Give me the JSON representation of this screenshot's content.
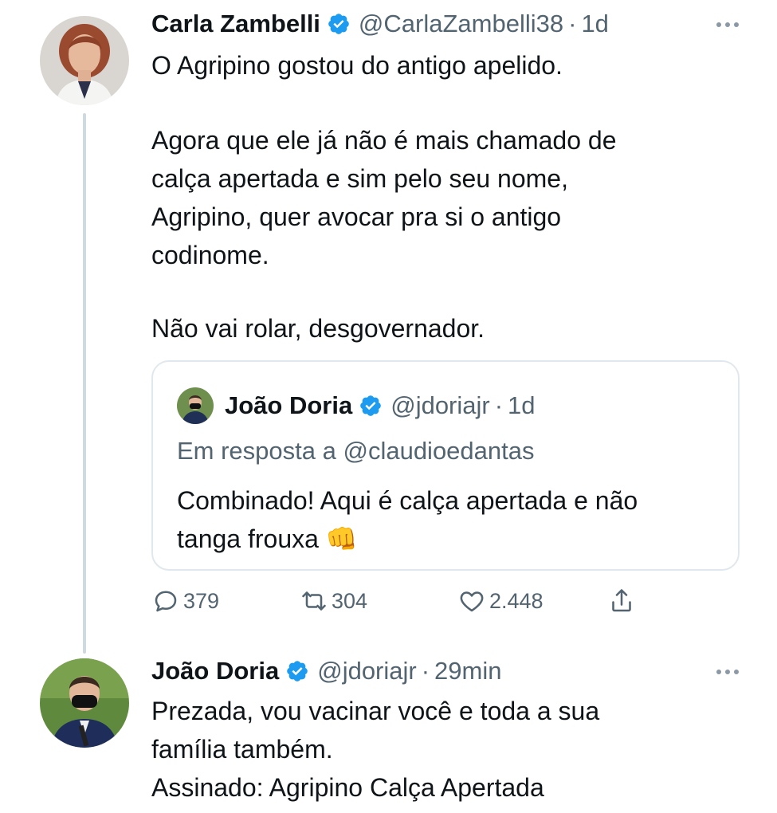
{
  "tweet": {
    "author_name": "Carla Zambelli",
    "handle": "@CarlaZambelli38",
    "separator": "·",
    "time": "1d",
    "lines": [
      "O Agripino gostou do antigo apelido.",
      "Agora que ele já não é mais chamado de",
      "calça apertada e sim pelo seu nome,",
      "Agripino, quer avocar pra si o antigo",
      "codinome.",
      "Não vai rolar, desgovernador."
    ],
    "quote": {
      "author_name": "João Doria",
      "handle": "@jdoriajr",
      "separator": "·",
      "time": "1d",
      "replying_to": "Em resposta a @claudioedantas",
      "lines": [
        "Combinado! Aqui é calça apertada e não",
        "tanga frouxa 👊"
      ]
    },
    "actions": {
      "replies": "379",
      "retweets": "304",
      "likes": "2.448"
    }
  },
  "reply": {
    "author_name": "João Doria",
    "handle": "@jdoriajr",
    "separator": "·",
    "time": "29min",
    "lines": [
      "Prezada, vou vacinar você e toda a sua",
      "família também.",
      "Assinado: Agripino Calça Apertada"
    ]
  },
  "colors": {
    "verified": "#1d9bf0",
    "secondary_text": "#536471",
    "thread_line": "#cfd9de"
  },
  "icons": [
    "verified-badge-icon",
    "more-icon",
    "reply-icon",
    "retweet-icon",
    "like-icon",
    "share-icon"
  ]
}
